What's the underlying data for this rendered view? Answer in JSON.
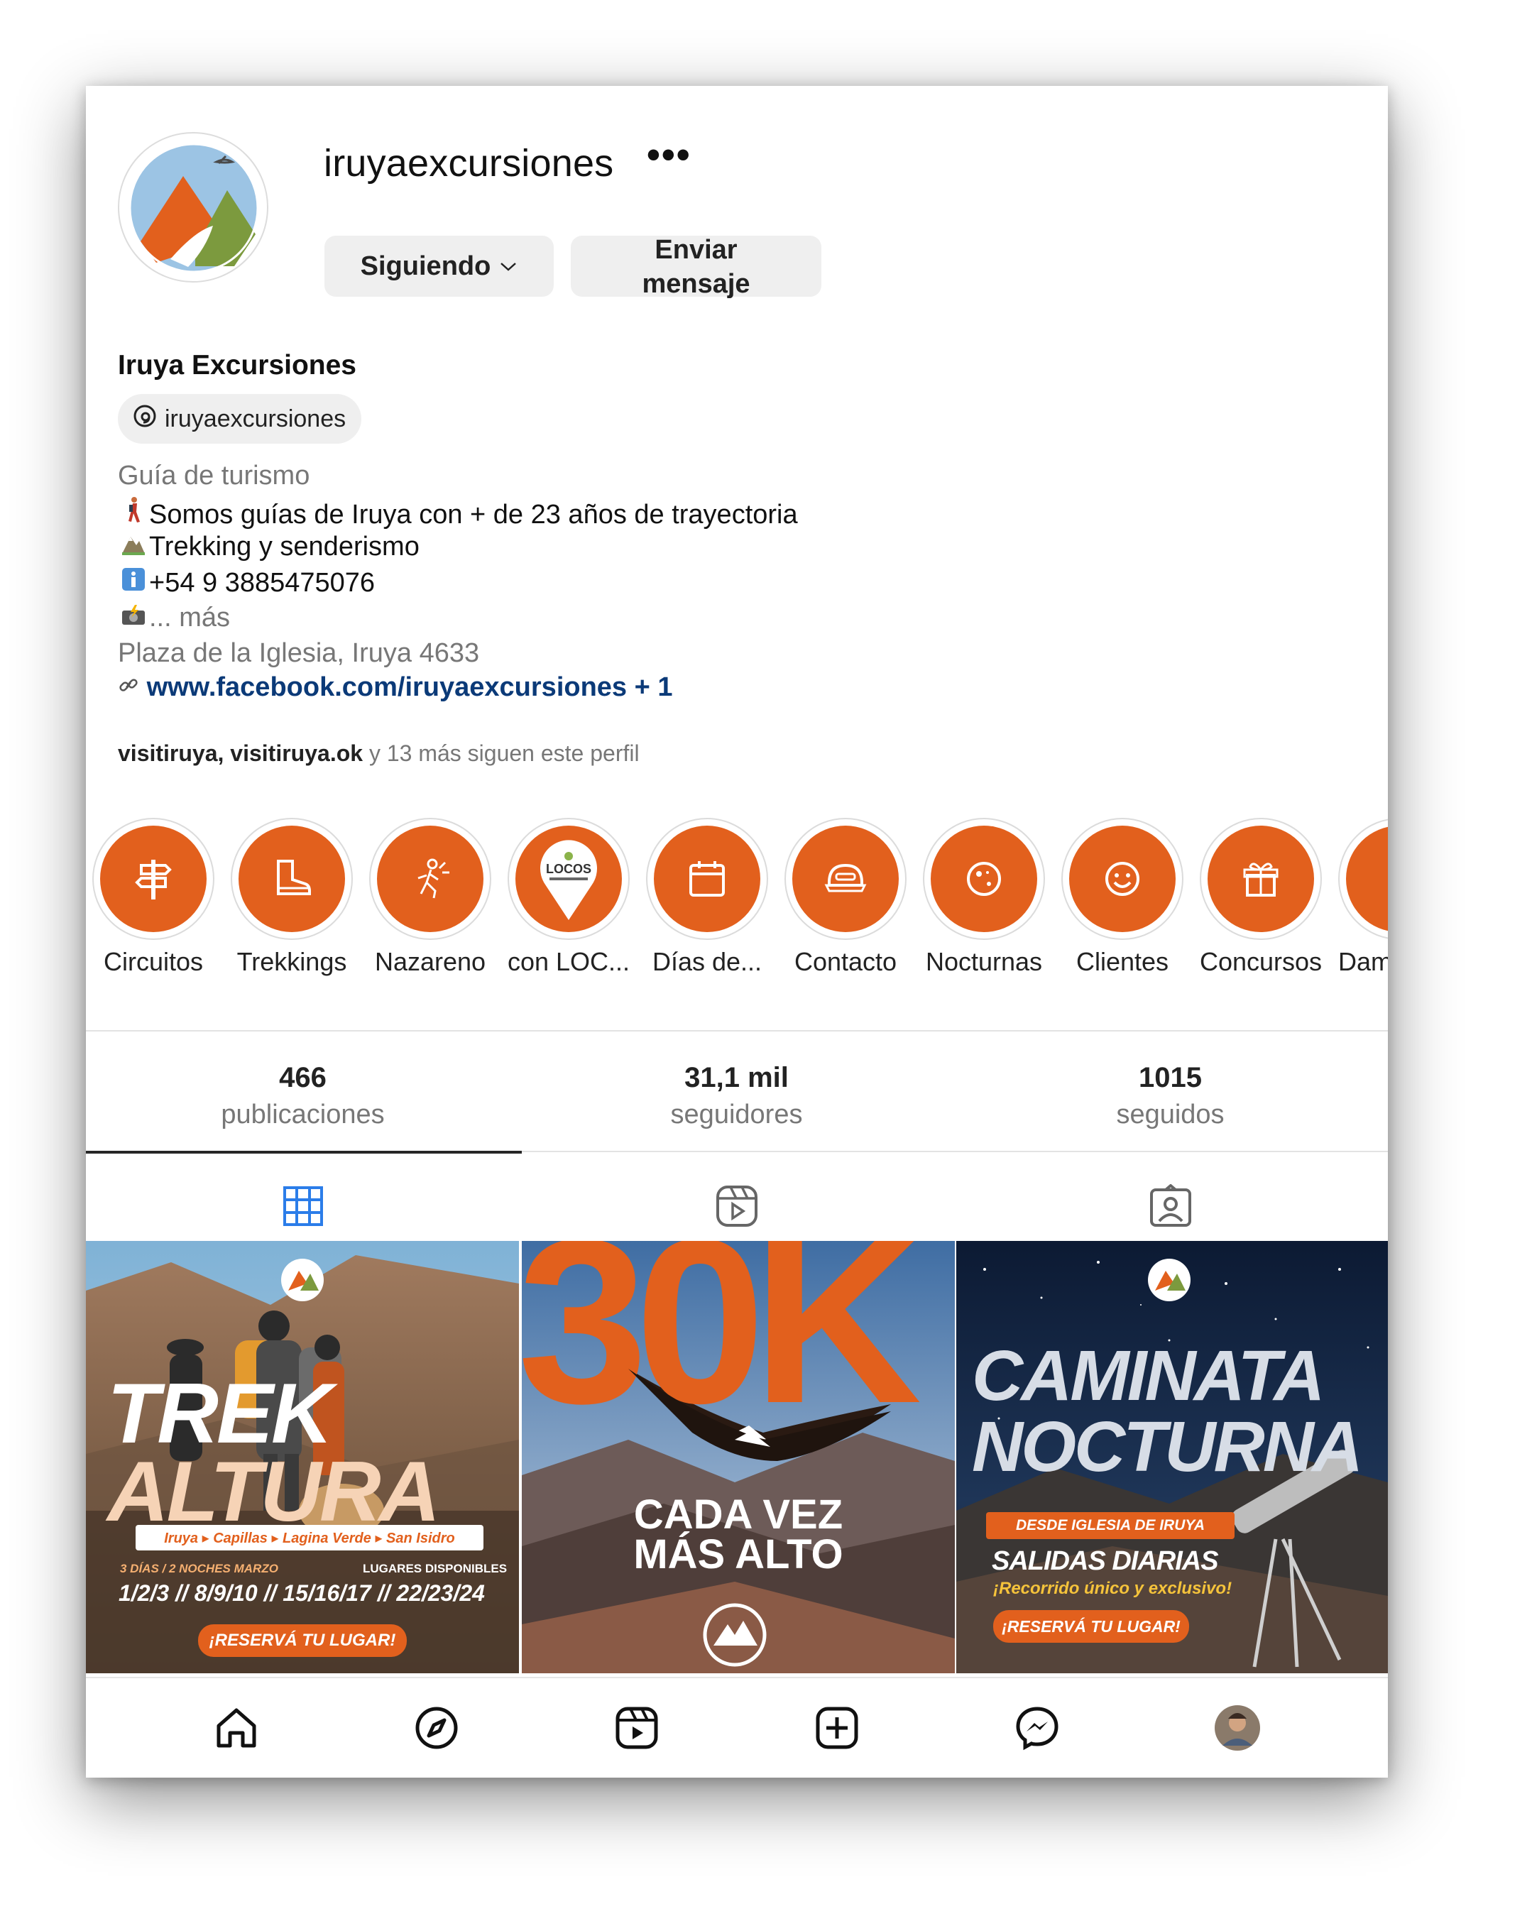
{
  "profile": {
    "username": "iruyaexcursiones",
    "more_label": "•••",
    "follow_button": "Siguiendo",
    "message_button_line1": "Enviar",
    "message_button_line2": "mensaje",
    "display_name": "Iruya Excursiones",
    "threads_handle": "iruyaexcursiones",
    "category": "Guía de turismo",
    "bio": [
      {
        "icon": "person-walking-emoji",
        "text": "Somos guías de Iruya con + de 23 años de trayectoria"
      },
      {
        "icon": "mountain-emoji",
        "text": "Trekking y senderismo"
      },
      {
        "icon": "info-emoji",
        "text": "+54 9 3885475076"
      },
      {
        "icon": "camera-flash-emoji",
        "text": "... más"
      }
    ],
    "address": "Plaza de la Iglesia, Iruya 4633",
    "link": "www.facebook.com/iruyaexcursiones + 1",
    "followed_by": {
      "names": "visitiruya, visitiruya.ok",
      "rest": " y 13 más siguen este perfil"
    }
  },
  "highlights": [
    {
      "label": "Circuitos",
      "icon": "signpost-icon"
    },
    {
      "label": "Trekkings",
      "icon": "boot-icon"
    },
    {
      "label": "Nazareno",
      "icon": "hiker-icon"
    },
    {
      "label": "con LOC...",
      "icon": "locos-pin-icon"
    },
    {
      "label": "Días de...",
      "icon": "calendar-icon"
    },
    {
      "label": "Contacto",
      "icon": "chat-icon"
    },
    {
      "label": "Nocturnas",
      "icon": "moon-icon"
    },
    {
      "label": "Clientes",
      "icon": "smiley-icon"
    },
    {
      "label": "Concursos",
      "icon": "gift-icon"
    },
    {
      "label": "Dam",
      "icon": "partial-icon"
    }
  ],
  "stats": [
    {
      "value": "466",
      "label": "publicaciones"
    },
    {
      "value": "31,1 mil",
      "label": "seguidores"
    },
    {
      "value": "1015",
      "label": "seguidos"
    }
  ],
  "tabs": [
    {
      "name": "grid-icon",
      "active": true
    },
    {
      "name": "reels-icon",
      "active": false
    },
    {
      "name": "tagged-icon",
      "active": false
    }
  ],
  "posts": [
    {
      "title_line1": "TREK",
      "title_line2": "ALTURA",
      "route": "Iruya ▸ Capillas ▸ Lagina Verde ▸ San Isidro",
      "duration": "3 DÍAS / 2 NOCHES",
      "month": "MARZO",
      "availability": "LUGARES DISPONIBLES",
      "dates": "1/2/3 // 8/9/10 // 15/16/17 // 22/23/24",
      "cta": "¡RESERVÁ TU LUGAR!"
    },
    {
      "big_text": "30K",
      "line1": "CADA VEZ",
      "line2": "MÁS ALTO"
    },
    {
      "title_line1": "CAMINATA",
      "title_line2": "NOCTURNA",
      "from": "DESDE IGLESIA DE IRUYA",
      "schedule": "SALIDAS DIARIAS",
      "tagline": "¡Recorrido único y exclusivo!",
      "cta": "¡RESERVÁ TU LUGAR!"
    }
  ],
  "nav": [
    "home-icon",
    "explore-icon",
    "reels-nav-icon",
    "create-icon",
    "messenger-icon",
    "profile-avatar"
  ],
  "colors": {
    "accent": "#e2601d",
    "link": "#0b3a78",
    "muted": "#777777",
    "button_bg": "#efefef"
  }
}
